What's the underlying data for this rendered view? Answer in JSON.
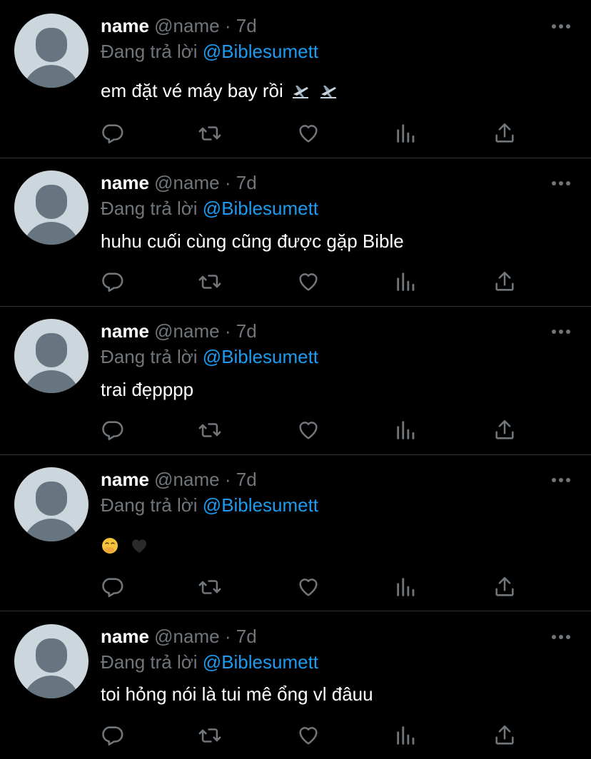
{
  "colors": {
    "background": "#000000",
    "divider": "#2f3336",
    "text_primary": "#ffffff",
    "text_secondary": "#71767b",
    "mention": "#1d9bf0",
    "avatar_bg": "#ccd6dd",
    "avatar_fg": "#66757f"
  },
  "replies": [
    {
      "display_name": "name",
      "handle": "@name",
      "separator": "·",
      "time": "7d",
      "reply_prefix": "Đang trả lời",
      "mention": "@Biblesumett",
      "text": "em đặt vé máy bay rồi",
      "emojis": [
        "airplane-departure-icon",
        "airplane-departure-icon"
      ]
    },
    {
      "display_name": "name",
      "handle": "@name",
      "separator": "·",
      "time": "7d",
      "reply_prefix": "Đang trả lời",
      "mention": "@Biblesumett",
      "text": "huhu cuối cùng cũng được gặp Bible",
      "emojis": []
    },
    {
      "display_name": "name",
      "handle": "@name",
      "separator": "·",
      "time": "7d",
      "reply_prefix": "Đang trả lời",
      "mention": "@Biblesumett",
      "text": "trai đẹpppp",
      "emojis": []
    },
    {
      "display_name": "name",
      "handle": "@name",
      "separator": "·",
      "time": "7d",
      "reply_prefix": "Đang trả lời",
      "mention": "@Biblesumett",
      "text": "",
      "emojis": [
        "face-with-hand-over-mouth-icon",
        "black-heart-icon"
      ]
    },
    {
      "display_name": "name",
      "handle": "@name",
      "separator": "·",
      "time": "7d",
      "reply_prefix": "Đang trả lời",
      "mention": "@Biblesumett",
      "text": "toi hỏng nói là tui mê ổng vl đâuu",
      "emojis": []
    }
  ],
  "action_icons": [
    "reply-icon",
    "retweet-icon",
    "like-icon",
    "views-icon",
    "share-icon"
  ],
  "more_icon": "more-icon"
}
